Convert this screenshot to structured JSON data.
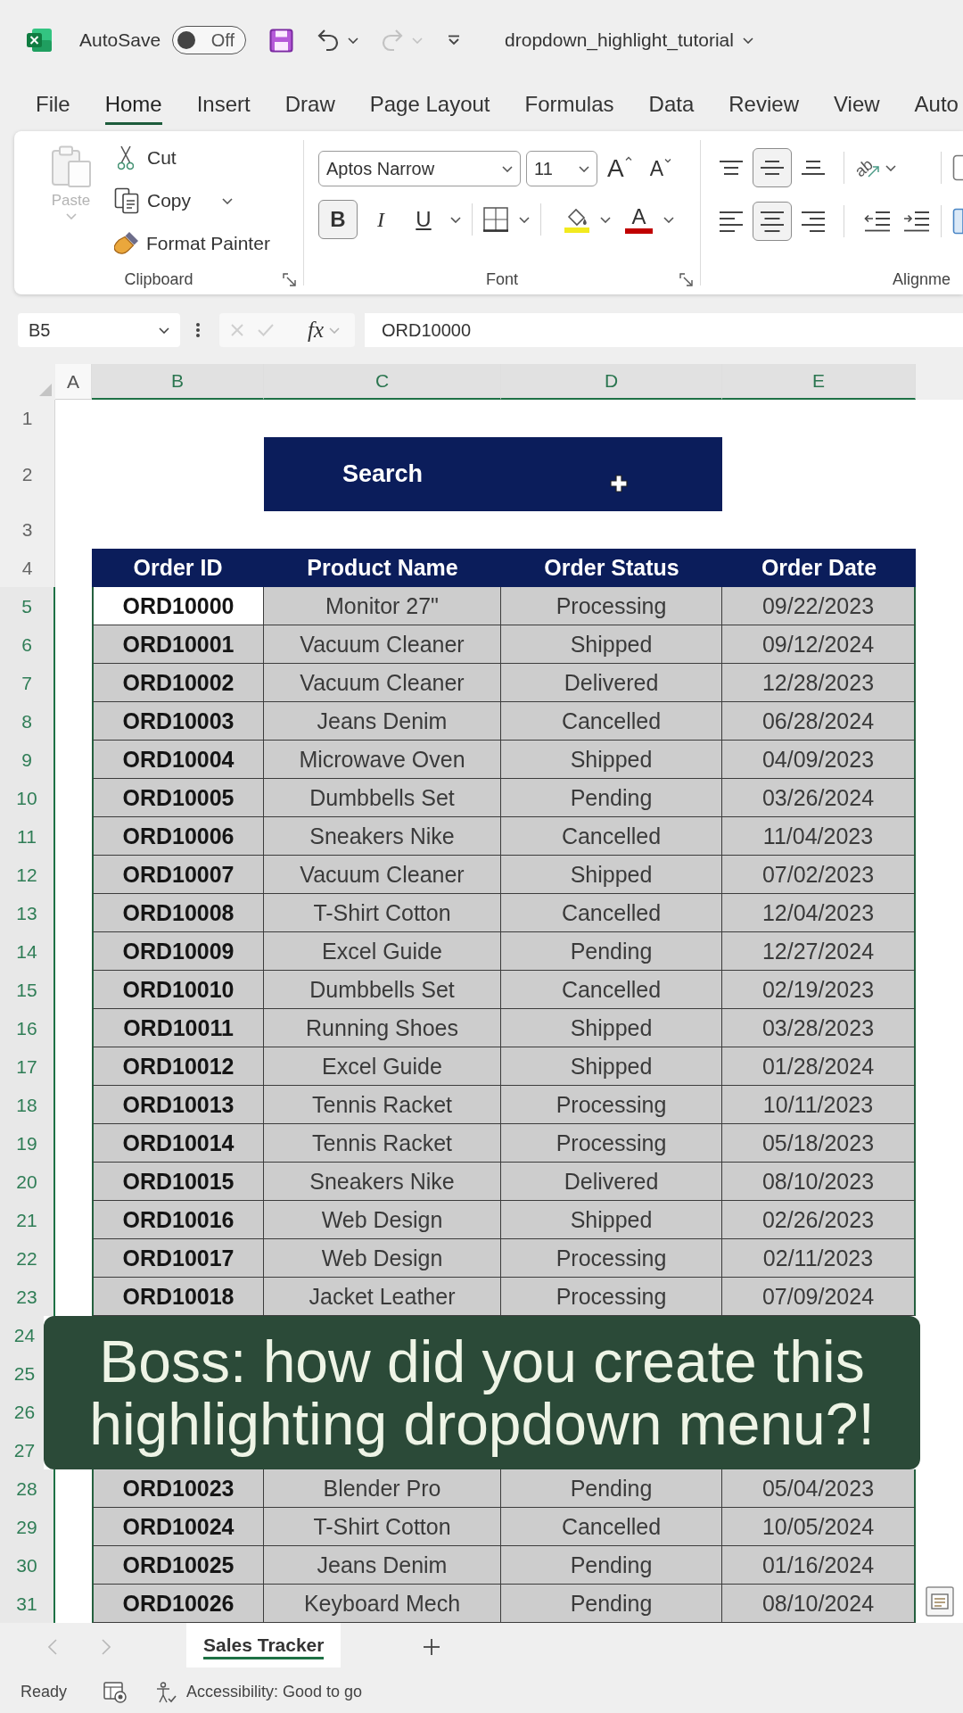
{
  "title_bar": {
    "autosave_label": "AutoSave",
    "autosave": {
      "on": false,
      "label": "Off"
    },
    "quick_access": [
      {
        "kind": "save",
        "disabled": false
      },
      {
        "kind": "undo",
        "disabled": false
      },
      {
        "kind": "redo",
        "disabled": true
      },
      {
        "kind": "customize",
        "disabled": false
      }
    ],
    "file_name": "dropdown_highlight_tutorial"
  },
  "ribbon_tabs": [
    {
      "label": "File",
      "selected": false
    },
    {
      "label": "Home",
      "selected": true
    },
    {
      "label": "Insert",
      "selected": false
    },
    {
      "label": "Draw",
      "selected": false
    },
    {
      "label": "Page Layout",
      "selected": false
    },
    {
      "label": "Formulas",
      "selected": false
    },
    {
      "label": "Data",
      "selected": false
    },
    {
      "label": "Review",
      "selected": false
    },
    {
      "label": "View",
      "selected": false
    },
    {
      "label": "Auto",
      "selected": false
    }
  ],
  "ribbon": {
    "clipboard": {
      "paste": {
        "label": "Paste",
        "disabled": true
      },
      "actions": [
        {
          "kind": "cut",
          "label": "Cut"
        },
        {
          "kind": "copy",
          "label": "Copy"
        },
        {
          "kind": "format_painter",
          "label": "Format Painter"
        }
      ],
      "label": "Clipboard"
    },
    "font": {
      "name": "Aptos Narrow",
      "size": "11",
      "grow": "A",
      "shrink": "A",
      "styles": [
        {
          "kind": "bold",
          "label": "B",
          "selected": true
        },
        {
          "kind": "italic",
          "label": "I",
          "selected": false
        },
        {
          "kind": "underline",
          "label": "U",
          "selected": false
        }
      ],
      "font_color": "A",
      "label": "Font"
    },
    "alignment": {
      "vertical": [
        {
          "kind": "top",
          "selected": false
        },
        {
          "kind": "middle",
          "selected": true
        },
        {
          "kind": "bottom",
          "selected": false
        }
      ],
      "orientation": "ab",
      "horizontal": [
        {
          "kind": "left",
          "selected": false
        },
        {
          "kind": "center",
          "selected": true
        },
        {
          "kind": "right",
          "selected": false
        }
      ],
      "label": "Alignme"
    }
  },
  "formula_bar": {
    "name_box": "B5",
    "edit_disabled": true,
    "function_label": "fx",
    "value": "ORD10000"
  },
  "sheet": {
    "columns": [
      {
        "label": "A",
        "selected": false
      },
      {
        "label": "B",
        "selected": true
      },
      {
        "label": "C",
        "selected": true
      },
      {
        "label": "D",
        "selected": true
      },
      {
        "label": "E",
        "selected": true
      }
    ],
    "rows": [
      {
        "number": "1",
        "kind": "blank",
        "selected": false
      },
      {
        "number": "2",
        "kind": "search",
        "selected": false,
        "label": "Search"
      },
      {
        "number": "3",
        "kind": "blank",
        "selected": false
      },
      {
        "number": "4",
        "kind": "header",
        "selected": false,
        "cells": [
          "Order ID",
          "Product Name",
          "Order Status",
          "Order Date"
        ]
      },
      {
        "number": "5",
        "kind": "data",
        "selected": true,
        "active": true,
        "cells": [
          "ORD10000",
          "Monitor 27\"",
          "Processing",
          "09/22/2023"
        ]
      },
      {
        "number": "6",
        "kind": "data",
        "selected": true,
        "active": false,
        "cells": [
          "ORD10001",
          "Vacuum Cleaner",
          "Shipped",
          "09/12/2024"
        ]
      },
      {
        "number": "7",
        "kind": "data",
        "selected": true,
        "active": false,
        "cells": [
          "ORD10002",
          "Vacuum Cleaner",
          "Delivered",
          "12/28/2023"
        ]
      },
      {
        "number": "8",
        "kind": "data",
        "selected": true,
        "active": false,
        "cells": [
          "ORD10003",
          "Jeans Denim",
          "Cancelled",
          "06/28/2024"
        ]
      },
      {
        "number": "9",
        "kind": "data",
        "selected": true,
        "active": false,
        "cells": [
          "ORD10004",
          "Microwave Oven",
          "Shipped",
          "04/09/2023"
        ]
      },
      {
        "number": "10",
        "kind": "data",
        "selected": true,
        "active": false,
        "cells": [
          "ORD10005",
          "Dumbbells Set",
          "Pending",
          "03/26/2024"
        ]
      },
      {
        "number": "11",
        "kind": "data",
        "selected": true,
        "active": false,
        "cells": [
          "ORD10006",
          "Sneakers Nike",
          "Cancelled",
          "11/04/2023"
        ]
      },
      {
        "number": "12",
        "kind": "data",
        "selected": true,
        "active": false,
        "cells": [
          "ORD10007",
          "Vacuum Cleaner",
          "Shipped",
          "07/02/2023"
        ]
      },
      {
        "number": "13",
        "kind": "data",
        "selected": true,
        "active": false,
        "cells": [
          "ORD10008",
          "T-Shirt Cotton",
          "Cancelled",
          "12/04/2023"
        ]
      },
      {
        "number": "14",
        "kind": "data",
        "selected": true,
        "active": false,
        "cells": [
          "ORD10009",
          "Excel Guide",
          "Pending",
          "12/27/2024"
        ]
      },
      {
        "number": "15",
        "kind": "data",
        "selected": true,
        "active": false,
        "cells": [
          "ORD10010",
          "Dumbbells Set",
          "Cancelled",
          "02/19/2023"
        ]
      },
      {
        "number": "16",
        "kind": "data",
        "selected": true,
        "active": false,
        "cells": [
          "ORD10011",
          "Running Shoes",
          "Shipped",
          "03/28/2023"
        ]
      },
      {
        "number": "17",
        "kind": "data",
        "selected": true,
        "active": false,
        "cells": [
          "ORD10012",
          "Excel Guide",
          "Shipped",
          "01/28/2024"
        ]
      },
      {
        "number": "18",
        "kind": "data",
        "selected": true,
        "active": false,
        "cells": [
          "ORD10013",
          "Tennis Racket",
          "Processing",
          "10/11/2023"
        ]
      },
      {
        "number": "19",
        "kind": "data",
        "selected": true,
        "active": false,
        "cells": [
          "ORD10014",
          "Tennis Racket",
          "Processing",
          "05/18/2023"
        ]
      },
      {
        "number": "20",
        "kind": "data",
        "selected": true,
        "active": false,
        "cells": [
          "ORD10015",
          "Sneakers Nike",
          "Delivered",
          "08/10/2023"
        ]
      },
      {
        "number": "21",
        "kind": "data",
        "selected": true,
        "active": false,
        "cells": [
          "ORD10016",
          "Web Design",
          "Shipped",
          "02/26/2023"
        ]
      },
      {
        "number": "22",
        "kind": "data",
        "selected": true,
        "active": false,
        "cells": [
          "ORD10017",
          "Web Design",
          "Processing",
          "02/11/2023"
        ]
      },
      {
        "number": "23",
        "kind": "data",
        "selected": true,
        "active": false,
        "cells": [
          "ORD10018",
          "Jacket Leather",
          "Processing",
          "07/09/2024"
        ]
      },
      {
        "number": "24",
        "kind": "data",
        "selected": true
      },
      {
        "number": "25",
        "kind": "data",
        "selected": true
      },
      {
        "number": "26",
        "kind": "data",
        "selected": true
      },
      {
        "number": "27",
        "kind": "data",
        "selected": true
      },
      {
        "number": "28",
        "kind": "data",
        "selected": true,
        "active": false,
        "cells": [
          "ORD10023",
          "Blender Pro",
          "Pending",
          "05/04/2023"
        ]
      },
      {
        "number": "29",
        "kind": "data",
        "selected": true,
        "active": false,
        "cells": [
          "ORD10024",
          "T-Shirt Cotton",
          "Cancelled",
          "10/05/2024"
        ]
      },
      {
        "number": "30",
        "kind": "data",
        "selected": true,
        "active": false,
        "cells": [
          "ORD10025",
          "Jeans Denim",
          "Pending",
          "01/16/2024"
        ]
      },
      {
        "number": "31",
        "kind": "data",
        "selected": true,
        "active": false,
        "cells": [
          "ORD10026",
          "Keyboard Mech",
          "Pending",
          "08/10/2024"
        ]
      }
    ]
  },
  "caption": "Boss: how did you create this highlighting dropdown menu?!",
  "sheet_tabs": {
    "scroll_disabled": true,
    "tabs": [
      {
        "label": "Sales Tracker",
        "selected": true
      }
    ]
  },
  "status_bar": {
    "mode": "Ready",
    "accessibility": "Accessibility: Good to go"
  }
}
